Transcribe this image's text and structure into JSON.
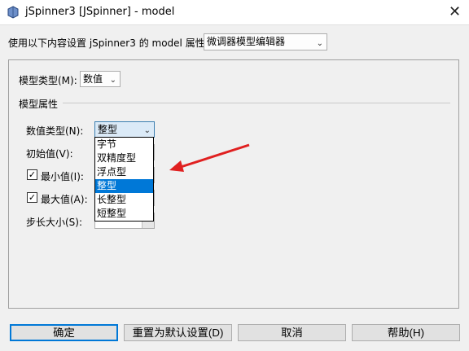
{
  "window": {
    "title": "jSpinner3 [JSpinner] - model",
    "close_glyph": "✕"
  },
  "editor": {
    "label": "使用以下内容设置 jSpinner3 的 model 属性：",
    "selected": "微调器模型编辑器"
  },
  "model_type": {
    "label": "模型类型(M):",
    "selected": "数值"
  },
  "section_title": "模型属性",
  "number_type": {
    "label": "数值类型(N):",
    "selected": "整型",
    "options": [
      "字节",
      "双精度型",
      "浮点型",
      "整型",
      "长整型",
      "短整型"
    ],
    "highlighted_index": 3
  },
  "initial_value": {
    "label": "初始值(V):"
  },
  "min_value": {
    "label": "最小值(I):",
    "checked": true
  },
  "max_value": {
    "label": "最大值(A):",
    "checked": true
  },
  "step_size": {
    "label": "步长大小(S):"
  },
  "buttons": {
    "ok": "确定",
    "reset": "重置为默认设置(D)",
    "cancel": "取消",
    "help": "帮助(H)"
  },
  "colors": {
    "selection": "#0078d7",
    "annotation_arrow": "#e02020"
  }
}
